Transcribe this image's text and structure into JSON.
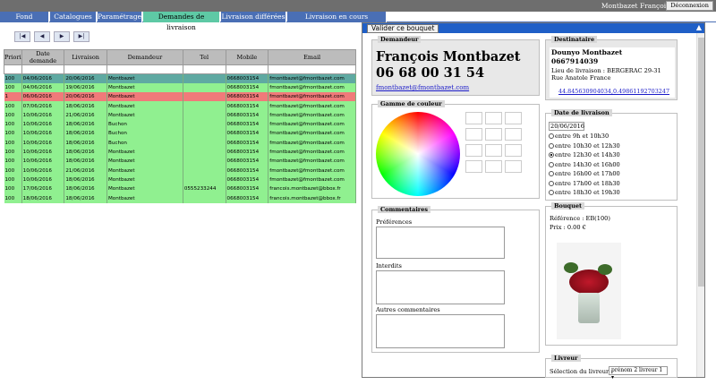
{
  "topbar": {
    "user_name": "Montbazet François",
    "logout_label": "Déconnexion"
  },
  "tabs": [
    {
      "label": "Fond d'images"
    },
    {
      "label": "Catalogues"
    },
    {
      "label": "Paramétrage"
    },
    {
      "label": "Demandes de livraison",
      "active": true
    },
    {
      "label": "Livraison différées"
    },
    {
      "label": "Livraison en cours d'acceptation"
    }
  ],
  "pager": {
    "first": "|◀",
    "prev": "◀",
    "next": "▶",
    "last": "▶|"
  },
  "grid": {
    "columns": [
      "Priori",
      "Date demande",
      "Livraison",
      "Demandeur",
      "Tel",
      "Mobile",
      "Email"
    ],
    "rows": [
      [
        "100",
        "04/06/2016",
        "20/06/2016",
        "Montbazet",
        "",
        "0668003154",
        "fmontbazet@fmontbazet.com",
        "sel"
      ],
      [
        "100",
        "04/06/2016",
        "19/06/2016",
        "Montbazet",
        "",
        "0668003154",
        "fmontbazet@fmontbazet.com",
        ""
      ],
      [
        "1",
        "06/06/2016",
        "20/06/2016",
        "Montbazet",
        "",
        "0668003154",
        "fmontbazet@fmontbazet.com",
        "red"
      ],
      [
        "100",
        "07/06/2016",
        "18/06/2016",
        "Montbazet",
        "",
        "0668003154",
        "fmontbazet@fmontbazet.com",
        ""
      ],
      [
        "100",
        "10/06/2016",
        "21/06/2016",
        "Montbazet",
        "",
        "0668003154",
        "fmontbazet@fmontbazet.com",
        ""
      ],
      [
        "100",
        "10/06/2016",
        "18/06/2016",
        "Buchon",
        "",
        "0668003154",
        "fmontbazet@fmontbazet.com",
        ""
      ],
      [
        "100",
        "10/06/2016",
        "18/06/2016",
        "Buchon",
        "",
        "0668003154",
        "fmontbazet@fmontbazet.com",
        ""
      ],
      [
        "100",
        "10/06/2016",
        "18/06/2016",
        "Buchon",
        "",
        "0668003154",
        "fmontbazet@fmontbazet.com",
        ""
      ],
      [
        "100",
        "10/06/2016",
        "18/06/2016",
        "Montbazet",
        "",
        "0668003154",
        "fmontbazet@fmontbazet.com",
        ""
      ],
      [
        "100",
        "10/06/2016",
        "18/06/2016",
        "Montbazet",
        "",
        "0668003154",
        "fmontbazet@fmontbazet.com",
        ""
      ],
      [
        "100",
        "10/06/2016",
        "21/06/2016",
        "Montbazet",
        "",
        "0668003154",
        "fmontbazet@fmontbazet.com",
        ""
      ],
      [
        "100",
        "10/06/2016",
        "18/06/2016",
        "Montbazet",
        "",
        "0668003154",
        "fmontbazet@fmontbazet.com",
        ""
      ],
      [
        "100",
        "17/06/2016",
        "18/06/2016",
        "Montbazet",
        "0555233244",
        "0668003154",
        "francois.montbazet@bbox.fr",
        ""
      ],
      [
        "100",
        "18/06/2016",
        "18/06/2016",
        "Montbazet",
        "",
        "0668003154",
        "francois.montbazet@bbox.fr",
        ""
      ]
    ]
  },
  "panel": {
    "validate_label": "Valider ce bouquet",
    "close_icon": "▲",
    "demandeur": {
      "legend": "Demandeur",
      "name": "François Montbazet",
      "phone": "06 68 00 31 54",
      "email": "fmontbazet@fmontbazet.com"
    },
    "destinataire": {
      "legend": "Destinataire",
      "name": "Dounyo Montbazet",
      "phone": "0667914039",
      "address": "Lieu de livraison : BERGERAC 29-31 Rue Anatole France",
      "coords": "44.845630904034,0.49861192703247"
    },
    "couleur": {
      "legend": "Gamme de couleur"
    },
    "comments": {
      "legend": "Commentaires",
      "preferences_label": "Préférences",
      "interdits_label": "Interdits",
      "autres_label": "Autres commentaires"
    },
    "date": {
      "legend": "Date de livraison",
      "value": "20/06/2016",
      "slots": [
        "entre 9h et 10h30",
        "entre 10h30 et 12h30",
        "entre 12h30 et 14h30",
        "entre 14h30 et 16h00",
        "entre 16h00 et 17h00",
        "entre 17h00 et 18h30",
        "entre 18h30 et 19h30"
      ],
      "selected_slot": 2
    },
    "bouquet": {
      "legend": "Bouquet",
      "reference": "Référence : EB(100)",
      "price": "Prix : 0.00 €"
    },
    "livreur": {
      "legend": "Livreur",
      "select_label": "Sélection du livreur :",
      "selected": "prénom 2 livreur 1"
    }
  }
}
